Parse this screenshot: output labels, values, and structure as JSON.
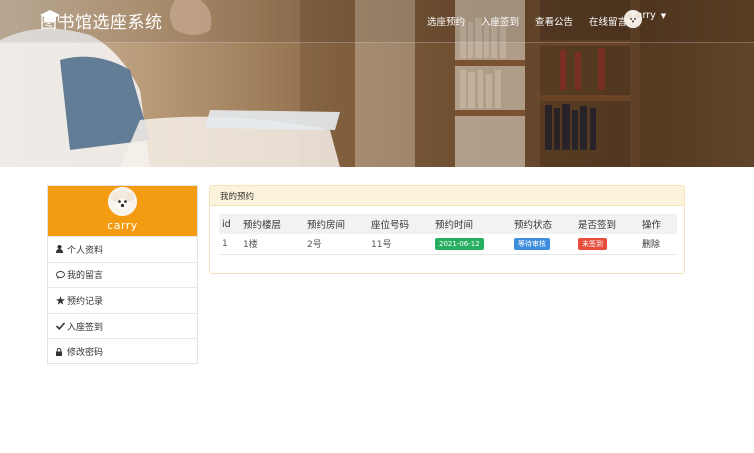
{
  "brand": {
    "title": "图书馆选座系统",
    "icon": "graduation-cap-icon"
  },
  "nav": {
    "links": [
      "选座预约",
      "入座签到",
      "查看公告",
      "在线留言"
    ],
    "user": {
      "name": "Carry",
      "avatar": "poodle-avatar"
    }
  },
  "sidebar": {
    "profile_name": "carry",
    "items": [
      {
        "icon": "user-icon",
        "label": "个人资料"
      },
      {
        "icon": "comment-icon",
        "label": "我的留言"
      },
      {
        "icon": "star-icon",
        "label": "预约记录"
      },
      {
        "icon": "check-icon",
        "label": "入座签到"
      },
      {
        "icon": "lock-icon",
        "label": "修改密码"
      }
    ]
  },
  "panel": {
    "title": "我的预约",
    "columns": [
      "id",
      "预约楼层",
      "预约房间",
      "座位号码",
      "预约时间",
      "预约状态",
      "是否签到",
      "操作"
    ],
    "rows": [
      {
        "id": "1",
        "floor": "1楼",
        "room": "2号",
        "seat": "11号",
        "time": "2021-06-12",
        "status": "等待审核",
        "signed": "未签到",
        "action": "删除"
      }
    ]
  },
  "colors": {
    "accent": "#f39c12",
    "green": "#27ae60",
    "blue": "#3c8dde",
    "red": "#e74c3c",
    "panel_border": "#f4e3b8"
  }
}
